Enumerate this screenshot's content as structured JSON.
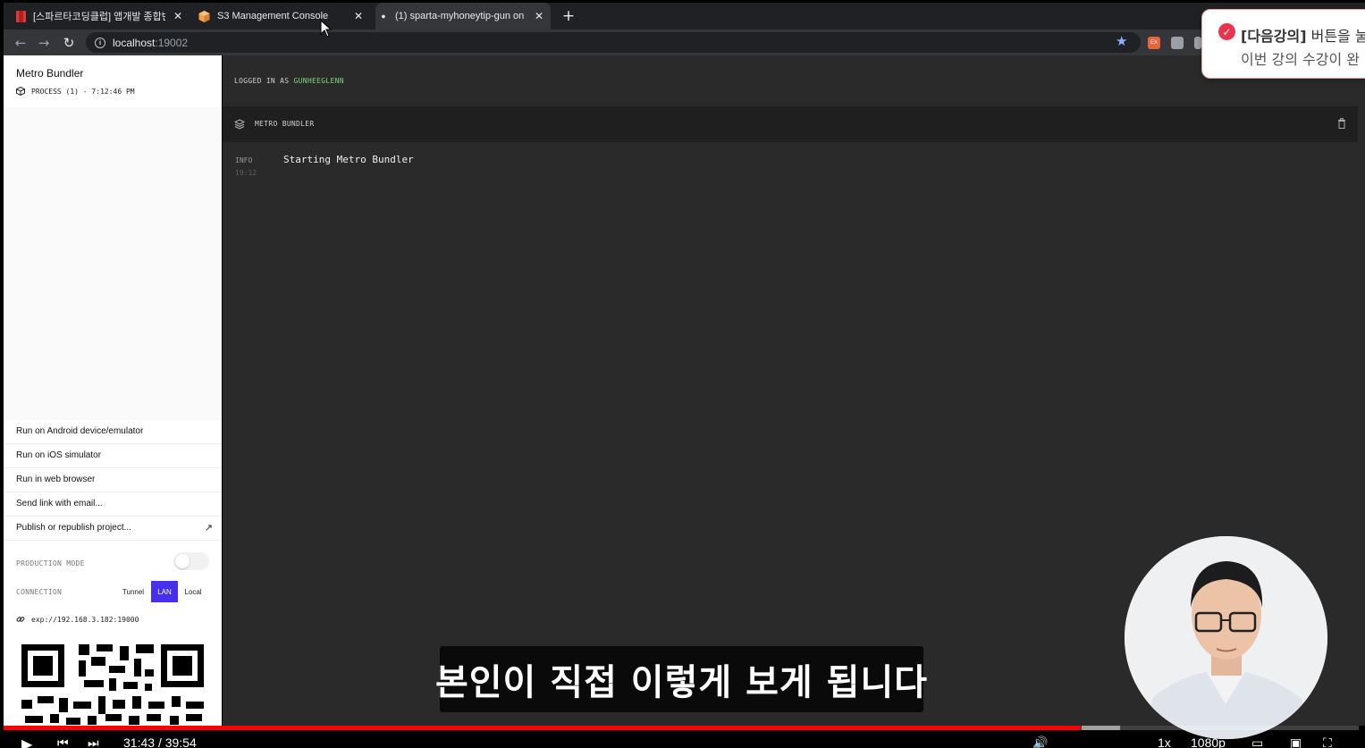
{
  "browser": {
    "tabs": [
      {
        "label": "[스파르타코딩클럽] 앱개발 종합반 -",
        "close": "✕"
      },
      {
        "label": "S3 Management Console",
        "close": "✕"
      },
      {
        "label": "(1) sparta-myhoneytip-gun on",
        "close": "✕"
      }
    ],
    "new_tab": "+",
    "back": "←",
    "forward": "→",
    "reload": "↻",
    "info_icon_text": "i",
    "url_host": "localhost",
    "url_port": ":19002",
    "bookmark_star": "★",
    "ext1_label": "EX"
  },
  "sidebar": {
    "title": "Metro Bundler",
    "process": "PROCESS (1) - 7:12:46 PM",
    "actions": [
      "Run on Android device/emulator",
      "Run on iOS simulator",
      "Run in web browser",
      "Send link with email...",
      "Publish or republish project..."
    ],
    "publish_arrow": "↗",
    "production_mode_label": "PRODUCTION MODE",
    "connection_label": "CONNECTION",
    "connection_options": [
      "Tunnel",
      "LAN",
      "Local"
    ],
    "connection_selected": "LAN",
    "exp_url": "exp://192.168.3.182:19000"
  },
  "main": {
    "logged_in_prefix": "LOGGED IN AS",
    "username": "GUNHEEGLENN",
    "panel_title": "METRO BUNDLER",
    "log": {
      "level": "INFO",
      "time": "19:12",
      "message": "Starting Metro Bundler"
    }
  },
  "toast": {
    "check": "✓",
    "line1_bold": "[다음강의]",
    "line1_rest": " 버튼을 눌",
    "line2": "이번 강의 수강이 완"
  },
  "video": {
    "subtitle": "본인이 직접 이렇게 보게 됩니다",
    "current_time": "31:43",
    "separator": "/",
    "duration": "39:54",
    "speed": "1x",
    "quality": "1080p",
    "progress_fraction": 0.795
  },
  "colors": {
    "accent_purple": "#4630eb",
    "username_green": "#7fd67f",
    "progress_red": "#ff0000",
    "toast_red": "#e8344e"
  }
}
